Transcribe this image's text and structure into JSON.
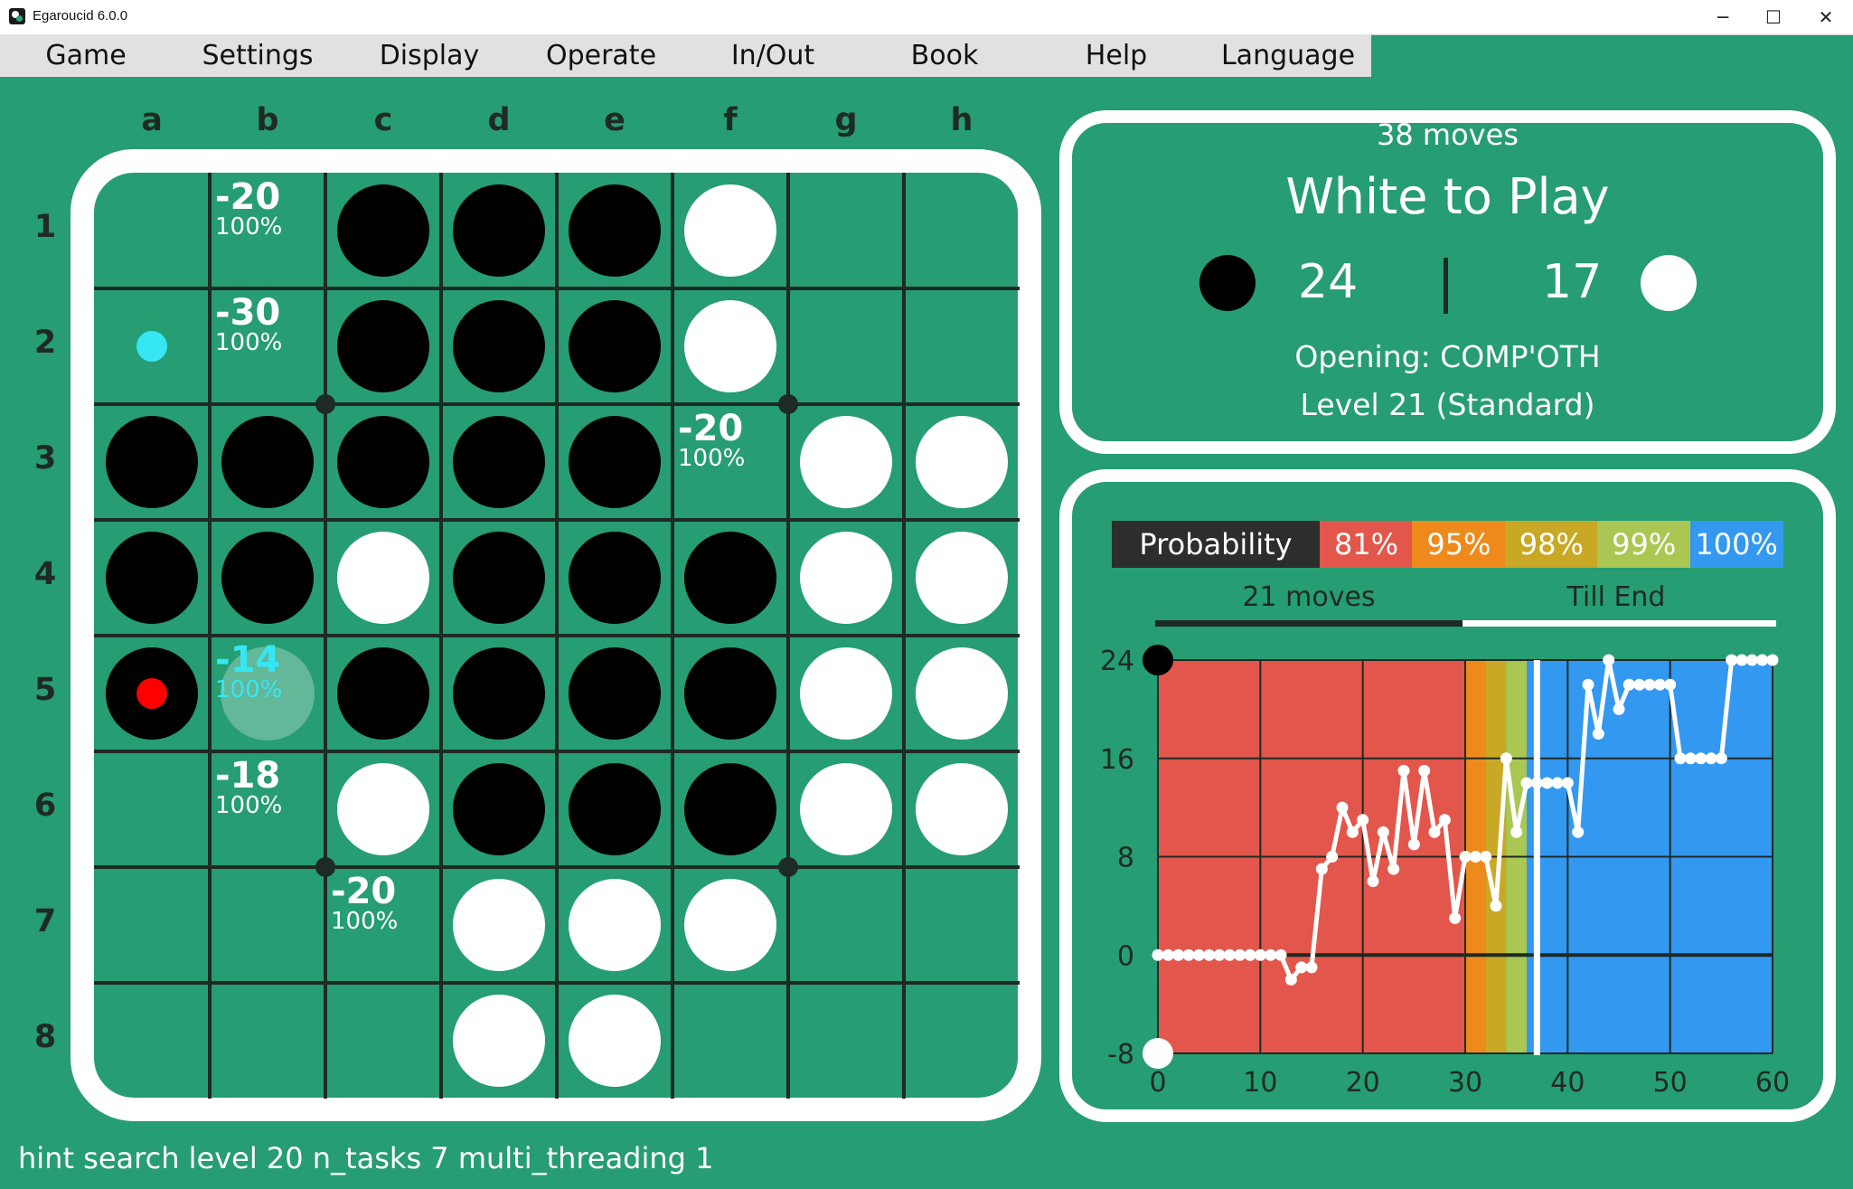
{
  "window": {
    "title": "Egaroucid 6.0.0",
    "controls": [
      "─",
      "☐",
      "✕"
    ]
  },
  "menu": [
    "Game",
    "Settings",
    "Display",
    "Operate",
    "In/Out",
    "Book",
    "Help",
    "Language"
  ],
  "board": {
    "columns": [
      "a",
      "b",
      "c",
      "d",
      "e",
      "f",
      "g",
      "h"
    ],
    "rows": [
      "1",
      "2",
      "3",
      "4",
      "5",
      "6",
      "7",
      "8"
    ],
    "grid": [
      "..BBBW..",
      "..BBBW..",
      "BBBBB.WW",
      "BBWBBBWW",
      "B.BBBBWW",
      "..WBBBWW",
      "...WWW..",
      "...WW..."
    ],
    "last_move": "a5",
    "legal_marker": "a2",
    "hints": [
      {
        "cell": "b1",
        "value": "-20",
        "pct": "100%"
      },
      {
        "cell": "b2",
        "value": "-30",
        "pct": "100%"
      },
      {
        "cell": "f3",
        "value": "-20",
        "pct": "100%"
      },
      {
        "cell": "b5",
        "value": "-14",
        "pct": "100%",
        "best": true
      },
      {
        "cell": "b6",
        "value": "-18",
        "pct": "100%"
      },
      {
        "cell": "c7",
        "value": "-20",
        "pct": "100%"
      }
    ]
  },
  "info": {
    "moves": "38 moves",
    "turn": "White to Play",
    "black_count": "24",
    "white_count": "17",
    "opening": "Opening: COMP'OTH",
    "level": "Level 21 (Standard)"
  },
  "graph_panel": {
    "probability_label": "Probability",
    "probability_buckets": [
      {
        "label": "81%",
        "color": "#e2564b"
      },
      {
        "label": "95%",
        "color": "#ee8a1c"
      },
      {
        "label": "98%",
        "color": "#c9a826"
      },
      {
        "label": "99%",
        "color": "#a9c752"
      },
      {
        "label": "100%",
        "color": "#3398f0"
      }
    ],
    "tabs": [
      "21 moves",
      "Till End"
    ]
  },
  "chart_data": {
    "type": "line",
    "title": "",
    "xlabel": "",
    "ylabel": "",
    "xlim": [
      0,
      60
    ],
    "ylim": [
      -8,
      24
    ],
    "xticks": [
      0,
      10,
      20,
      30,
      40,
      50,
      60
    ],
    "yticks": [
      24,
      16,
      8,
      0,
      -8
    ],
    "grid": true,
    "background_bands": [
      {
        "from": 0,
        "to": 30,
        "color": "#e2564b"
      },
      {
        "from": 30,
        "to": 32,
        "color": "#ee8a1c"
      },
      {
        "from": 32,
        "to": 34,
        "color": "#c9a826"
      },
      {
        "from": 34,
        "to": 36,
        "color": "#a9c752"
      },
      {
        "from": 36,
        "to": 60,
        "color": "#3398f0"
      }
    ],
    "current_move": 37,
    "series": [
      {
        "x": [
          0,
          1,
          2,
          3,
          4,
          5,
          6,
          7,
          8,
          9,
          10,
          11,
          12,
          13,
          14,
          15,
          16,
          17,
          18,
          19,
          20,
          21,
          22,
          23,
          24,
          25,
          26,
          27,
          28,
          29,
          30,
          31,
          32,
          33,
          34,
          35,
          36,
          37,
          38,
          39,
          40,
          41,
          42,
          43,
          44,
          45,
          46,
          47,
          48,
          49,
          50,
          51,
          52,
          53,
          54,
          55,
          56,
          57,
          58,
          59,
          60
        ],
        "values": [
          0,
          0,
          0,
          0,
          0,
          0,
          0,
          0,
          0,
          0,
          0,
          0,
          0,
          -2,
          -1,
          -1,
          7,
          8,
          12,
          10,
          11,
          6,
          10,
          7,
          15,
          9,
          15,
          10,
          11,
          3,
          8,
          8,
          8,
          4,
          16,
          10,
          14,
          14,
          14,
          14,
          14,
          10,
          22,
          18,
          24,
          20,
          22,
          22,
          22,
          22,
          22,
          16,
          16,
          16,
          16,
          16,
          24,
          24,
          24,
          24,
          24
        ]
      }
    ],
    "markers": [
      {
        "label": "24",
        "y": 24,
        "color": "#000000"
      },
      {
        "label": "-8",
        "y": -8,
        "color": "#ffffff"
      }
    ]
  },
  "status": "hint search level 20 n_tasks 7 multi_threading 1"
}
